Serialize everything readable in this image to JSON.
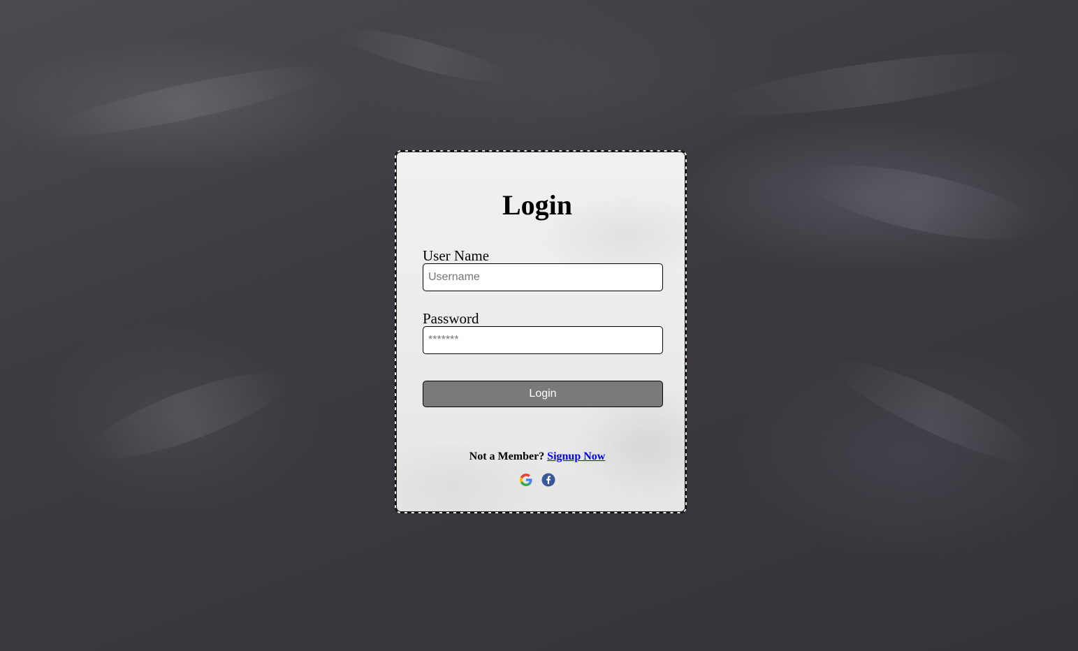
{
  "login_card": {
    "title": "Login",
    "username": {
      "label": "User Name",
      "placeholder": "Username",
      "value": ""
    },
    "password": {
      "label": "Password",
      "placeholder": "*******",
      "value": ""
    },
    "login_button_label": "Login",
    "signup_prompt": "Not a Member?",
    "signup_link_label": "Signup Now",
    "social_icons": [
      "google-icon",
      "facebook-icon"
    ]
  },
  "colors": {
    "background": "#3c3b40",
    "card_background": "#ececec",
    "button_background": "#7a7a7a",
    "link": "#0000ee",
    "facebook_blue": "#3b5998"
  }
}
